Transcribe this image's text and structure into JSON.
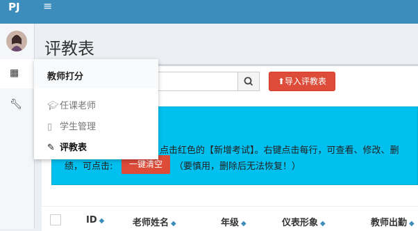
{
  "header": {
    "logo": "PJ",
    "menu_icon": "hamburger-icon"
  },
  "sidebar": {
    "items": [
      {
        "icon": "calculator-icon"
      },
      {
        "icon": "wrench-icon"
      }
    ]
  },
  "page": {
    "title": "评教表"
  },
  "toolbar": {
    "import_label": "导入评教表",
    "search_placeholder": ""
  },
  "popup": {
    "heading": "教师打分",
    "items": [
      {
        "icon": "graduation-cap-icon",
        "label": "任课老师"
      },
      {
        "icon": "building-icon",
        "label": "学生管理"
      },
      {
        "icon": "edit-icon",
        "label": "评教表"
      }
    ]
  },
  "callout": {
    "line1": "点击红色的【新增考试】。右键点击每行，可查看、修改、删",
    "line2_prefix": "绩，可点击:",
    "clear_label": "一键清空",
    "line2_suffix": "（要慎用，删除后无法恢复！）"
  },
  "table": {
    "headers": [
      "ID",
      "老师姓名",
      "年级",
      "仪表形象",
      "教师出勤"
    ]
  },
  "colors": {
    "accent": "#3c8dbc",
    "danger": "#dd4b39",
    "info": "#00c0ef"
  }
}
